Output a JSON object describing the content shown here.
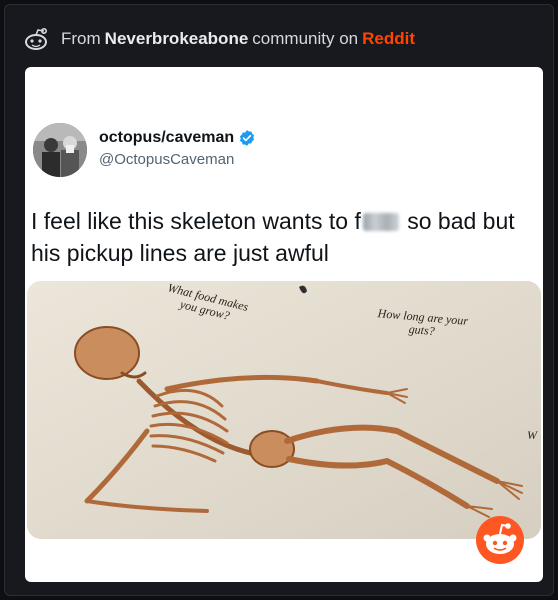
{
  "source": {
    "prefix": "From",
    "community": "Neverbrokeabone",
    "suffix": "community on",
    "platform": "Reddit",
    "brand_color": "#ff4500"
  },
  "tweet": {
    "author_name": "octopus/caveman",
    "author_handle": "@OctopusCaveman",
    "verified": true,
    "verified_icon": "verified-badge-icon",
    "text_before": "I feel like this skeleton wants to f",
    "text_after": "so bad but his pickup lines are just awful",
    "censored": true
  },
  "image": {
    "captions": {
      "left_line1": "What food makes",
      "left_line2": "you grow?",
      "right_line1": "How long are your",
      "right_line2": "guts?",
      "edge": "W"
    }
  },
  "icons": {
    "reddit": "reddit-snoo-icon",
    "source": "reddit-logo-icon"
  }
}
